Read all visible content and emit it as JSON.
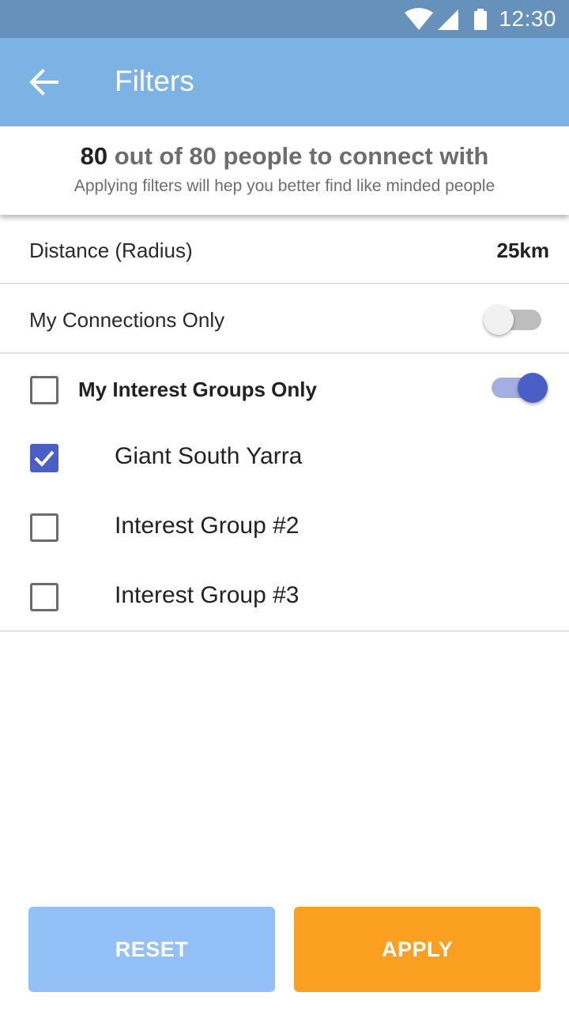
{
  "status_bar": {
    "time": "12:30",
    "icons": [
      "wifi-icon",
      "signal-icon",
      "battery-icon"
    ]
  },
  "app_bar": {
    "back_icon": "arrow-left-icon",
    "title": "Filters"
  },
  "summary": {
    "count_shown": "80",
    "count_text": " out of 80 people to connect with",
    "subtitle": "Applying filters will hep you better find like minded people"
  },
  "filters": {
    "distance": {
      "label": "Distance (Radius)",
      "value": "25km"
    },
    "connections_only": {
      "label": "My Connections Only",
      "enabled": false
    },
    "interest_groups_only": {
      "label": "My Interest Groups Only",
      "checked": false,
      "enabled": true
    },
    "groups": [
      {
        "label": "Giant South Yarra",
        "checked": true
      },
      {
        "label": "Interest Group #2",
        "checked": false
      },
      {
        "label": "Interest Group #3",
        "checked": false
      }
    ]
  },
  "actions": {
    "reset_label": "RESET",
    "apply_label": "APPLY"
  },
  "colors": {
    "status_bar": "#6591bb",
    "app_bar": "#7db2e4",
    "accent": "#4a5ec5",
    "reset_button": "#93c0f7",
    "apply_button": "#fba021"
  }
}
